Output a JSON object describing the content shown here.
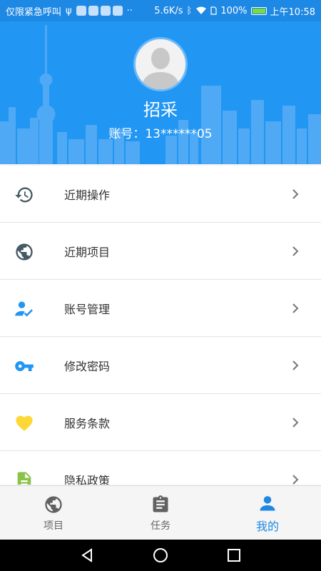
{
  "status_bar": {
    "left_text": "仅限紧急呼叫",
    "speed": "5.6K/s",
    "battery": "100%",
    "time": "上午10:58"
  },
  "profile": {
    "name": "招采",
    "account_label": "账号：",
    "account_value": "13******05"
  },
  "menu": {
    "items": [
      {
        "label": "近期操作",
        "icon": "history-icon",
        "color": "#455a64"
      },
      {
        "label": "近期项目",
        "icon": "globe-icon",
        "color": "#455a64"
      },
      {
        "label": "账号管理",
        "icon": "account-check-icon",
        "color": "#2196f3"
      },
      {
        "label": "修改密码",
        "icon": "key-icon",
        "color": "#2196f3"
      },
      {
        "label": "服务条款",
        "icon": "heart-icon",
        "color": "#fdd835"
      },
      {
        "label": "隐私政策",
        "icon": "document-icon",
        "color": "#8bc34a"
      }
    ]
  },
  "bottom_nav": {
    "tabs": [
      {
        "label": "项目",
        "icon": "globe-icon",
        "active": false
      },
      {
        "label": "任务",
        "icon": "clipboard-icon",
        "active": false
      },
      {
        "label": "我的",
        "icon": "person-icon",
        "active": true
      }
    ]
  },
  "colors": {
    "primary": "#2196f3",
    "status_bar": "#1e88e5",
    "active_tab": "#1e88e5",
    "icon_gray": "#455a64"
  }
}
